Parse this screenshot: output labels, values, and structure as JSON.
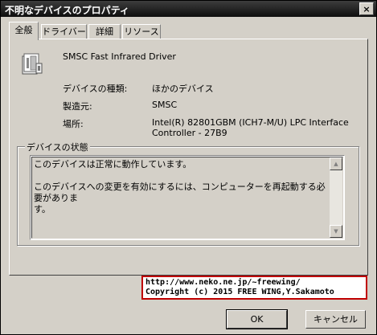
{
  "window": {
    "title": "不明なデバイスのプロパティ",
    "close_glyph": "×"
  },
  "tabs": [
    "全般",
    "ドライバー",
    "詳細",
    "リソース"
  ],
  "device": {
    "icon": "device-icon",
    "name": "SMSC Fast Infrared Driver",
    "type_label": "デバイスの種類:",
    "type_value": "ほかのデバイス",
    "maker_label": "製造元:",
    "maker_value": "SMSC",
    "location_label": "場所:",
    "location_line1": "Intel(R) 82801GBM (ICH7-M/U) LPC Interface",
    "location_line2": "Controller - 27B9"
  },
  "status": {
    "title": "デバイスの状態",
    "text": "このデバイスは正常に動作しています。\n\nこのデバイスへの変更を有効にするには、コンピューターを再起動する必要がありま\nす。"
  },
  "info": {
    "line1": "http://www.neko.ne.jp/~freewing/",
    "line2": "Copyright (c) 2015 FREE WING,Y.Sakamoto",
    "border_color": "#c00000"
  },
  "buttons": {
    "ok": "OK",
    "cancel": "キャンセル"
  }
}
